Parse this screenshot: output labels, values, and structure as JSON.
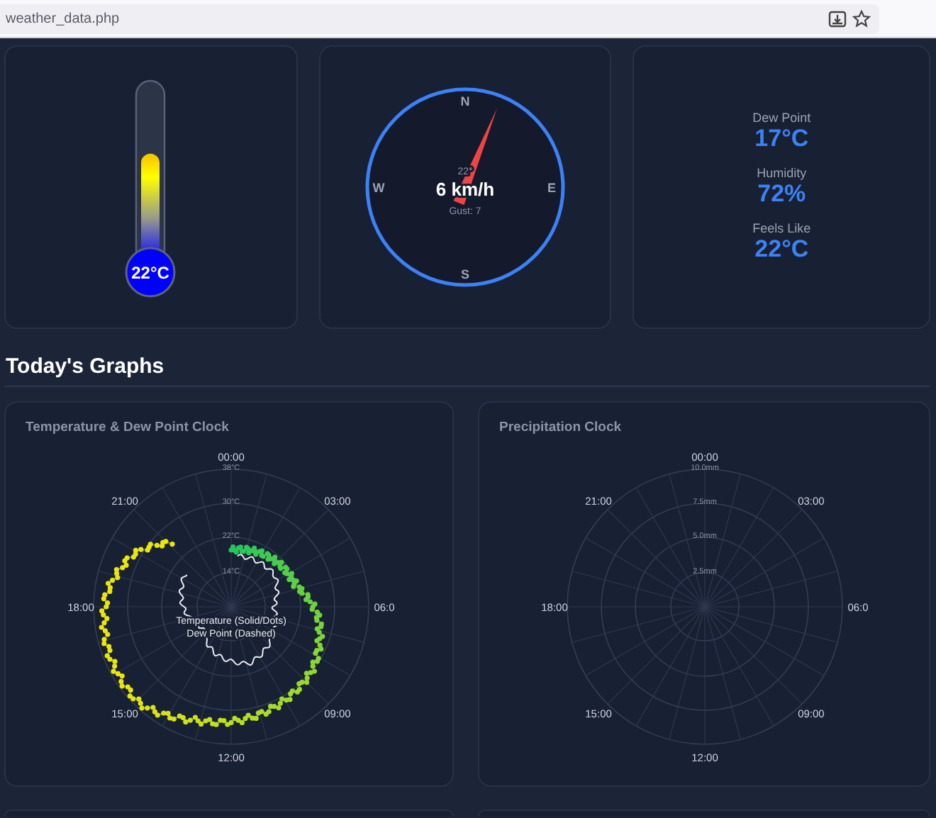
{
  "address_bar": {
    "url": "weather_data.php"
  },
  "thermometer": {
    "reading": "22°C",
    "level": 0.62
  },
  "wind": {
    "compass_points": [
      "N",
      "E",
      "S",
      "W"
    ],
    "direction": "22°",
    "speed": "6 km/h",
    "gust": "Gust: 7"
  },
  "stats": [
    {
      "label": "Dew Point",
      "value": "17°C"
    },
    {
      "label": "Humidity",
      "value": "72%"
    },
    {
      "label": "Feels Like",
      "value": "22°C"
    }
  ],
  "section_title": "Today's Graphs",
  "charts": [
    {
      "kind": "temperature",
      "title": "Temperature & Dew Point Clock",
      "hour_labels": [
        "00:00",
        "03:00",
        "06:0",
        "09:00",
        "12:00",
        "15:00",
        "18:00",
        "21:00"
      ],
      "ring_labels": [
        "38°C",
        "30°C",
        "22°C",
        "14°C"
      ],
      "legend": [
        "Temperature (Solid/Dots)",
        "Dew Point (Dashed)"
      ]
    },
    {
      "kind": "precipitation",
      "title": "Precipitation Clock",
      "hour_labels": [
        "00:00",
        "03:00",
        "06:0",
        "09:00",
        "12:00",
        "15:00",
        "18:00",
        "21:00"
      ],
      "ring_labels": [
        "10.0mm",
        "7.5mm",
        "5.0mm",
        "2.5mm"
      ]
    }
  ]
}
